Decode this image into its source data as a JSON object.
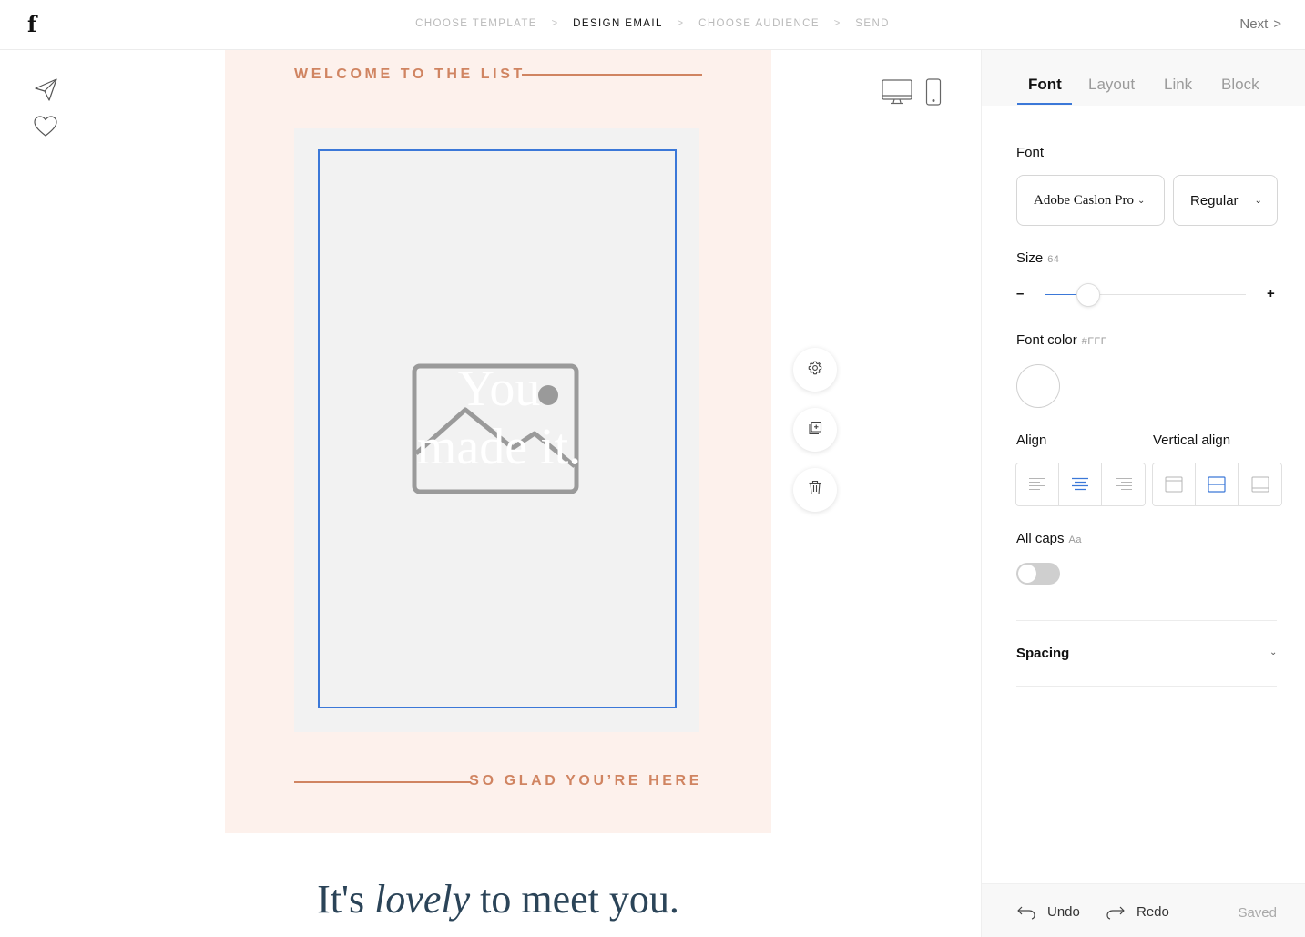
{
  "header": {
    "logo": "f",
    "steps": [
      {
        "label": "CHOOSE TEMPLATE",
        "state": "inactive"
      },
      {
        "label": "DESIGN EMAIL",
        "state": "active"
      },
      {
        "label": "CHOOSE AUDIENCE",
        "state": "inactive"
      },
      {
        "label": "SEND",
        "state": "inactive"
      }
    ],
    "step_separator": ">",
    "next_label": "Next",
    "next_chevron": ">"
  },
  "left_rail": {
    "icons": [
      "paper-plane-icon",
      "heart-icon"
    ]
  },
  "email": {
    "heading_top": "WELCOME TO THE LIST",
    "image_overlay_line1": "You",
    "image_overlay_line2": "made it.",
    "heading_bottom": "SO GLAD YOU’RE HERE",
    "body_start": "It's ",
    "body_emphasis": "lovely",
    "body_end": " to meet you.",
    "accent_color": "#d08461",
    "background_color": "#fdf1ec"
  },
  "device_toggle": {
    "options": [
      "desktop-icon",
      "mobile-icon"
    ]
  },
  "block_actions": [
    "gear-icon",
    "duplicate-icon",
    "trash-icon"
  ],
  "panel": {
    "tabs": [
      {
        "label": "Font",
        "active": true
      },
      {
        "label": "Layout",
        "active": false
      },
      {
        "label": "Link",
        "active": false
      },
      {
        "label": "Block",
        "active": false
      }
    ],
    "font_label": "Font",
    "font_family_value": "Adobe Caslon Pro",
    "font_weight_value": "Regular",
    "size_label": "Size",
    "size_value": "64",
    "minus": "–",
    "plus": "+",
    "font_color_label": "Font color",
    "font_color_value": "#FFF",
    "align_label": "Align",
    "align_options": [
      "left",
      "center",
      "right"
    ],
    "align_selected": "center",
    "vertical_align_label": "Vertical align",
    "vertical_align_options": [
      "top",
      "middle",
      "bottom"
    ],
    "vertical_align_selected": "middle",
    "all_caps_label": "All caps",
    "all_caps_hint": "Aa",
    "all_caps_on": false,
    "spacing_label": "Spacing",
    "undo_label": "Undo",
    "redo_label": "Redo",
    "status": "Saved",
    "accent_color": "#3b78d8"
  }
}
